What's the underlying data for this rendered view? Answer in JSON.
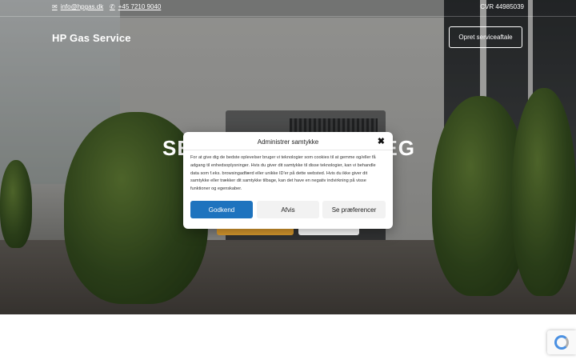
{
  "topbar": {
    "email": "info@hpgas.dk",
    "phone": "+45 7210 9040",
    "cvr": "CVR 44985039"
  },
  "header": {
    "brand": "HP Gas Service",
    "cta_label": "Opret serviceaftale"
  },
  "hero": {
    "headline_left": "SE",
    "headline_right": "EG"
  },
  "consent": {
    "title": "Administrer samtykke",
    "body": "For at give dig de bedste oplevelser bruger vi teknologier som cookies til at gemme og/eller få adgang til enhedsoplysninger. Hvis du giver dit samtykke til disse teknologier, kan vi behandle data som f.eks. browsingadfærd eller unikke ID'er på dette websted. Hvis du ikke giver dit samtykke eller trækker dit samtykke tilbage, kan det have en negativ indvirkning på visse funktioner og egenskaber.",
    "accept_label": "Godkend",
    "deny_label": "Afvis",
    "prefs_label": "Se præferencer"
  },
  "icons": {
    "email": "envelope-icon",
    "phone": "phone-icon",
    "close": "close-icon",
    "recaptcha": "recaptcha-icon"
  },
  "colors": {
    "accept": "#1e73be",
    "hero_primary_button": "#d99a2e"
  }
}
